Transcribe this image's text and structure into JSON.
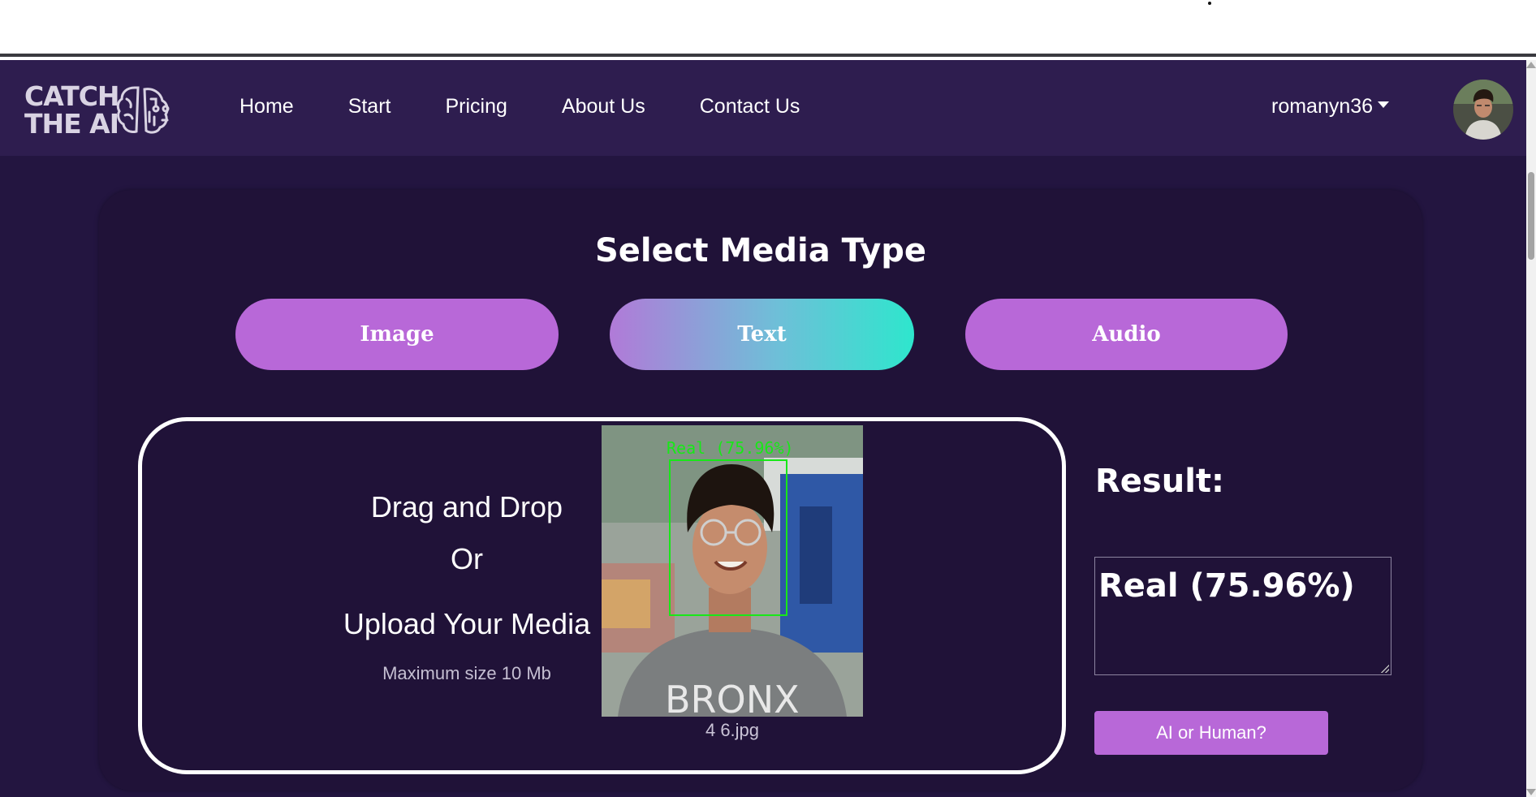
{
  "brand": {
    "logo_line1": "CATCH",
    "logo_line2": "THE AI",
    "logo_icon": "brain-circuit-icon"
  },
  "nav": {
    "items": [
      {
        "label": "Home"
      },
      {
        "label": "Start"
      },
      {
        "label": "Pricing"
      },
      {
        "label": "About Us"
      },
      {
        "label": "Contact Us"
      }
    ]
  },
  "user": {
    "username": "romanyn36",
    "menu_icon": "caret-down-icon",
    "avatar": "profile-photo"
  },
  "main": {
    "title": "Select Media Type",
    "media_types": [
      {
        "label": "Image",
        "selected": false
      },
      {
        "label": "Text",
        "selected": true
      },
      {
        "label": "Audio",
        "selected": false
      }
    ],
    "upload": {
      "line1": "Drag and Drop",
      "line2": "Or",
      "line3": "Upload Your Media",
      "note": "Maximum size 10 Mb",
      "preview_label": "Real (75.96%)",
      "filename": "4 6.jpg"
    },
    "result": {
      "label": "Result:",
      "value": "Real (75.96%)",
      "button": "AI or Human?"
    }
  },
  "colors": {
    "page_bg": "#231540",
    "navbar_bg": "#2e1d4f",
    "accent": "#b868d8",
    "teal": "#2ee6cd",
    "detect_green": "#18e818"
  }
}
